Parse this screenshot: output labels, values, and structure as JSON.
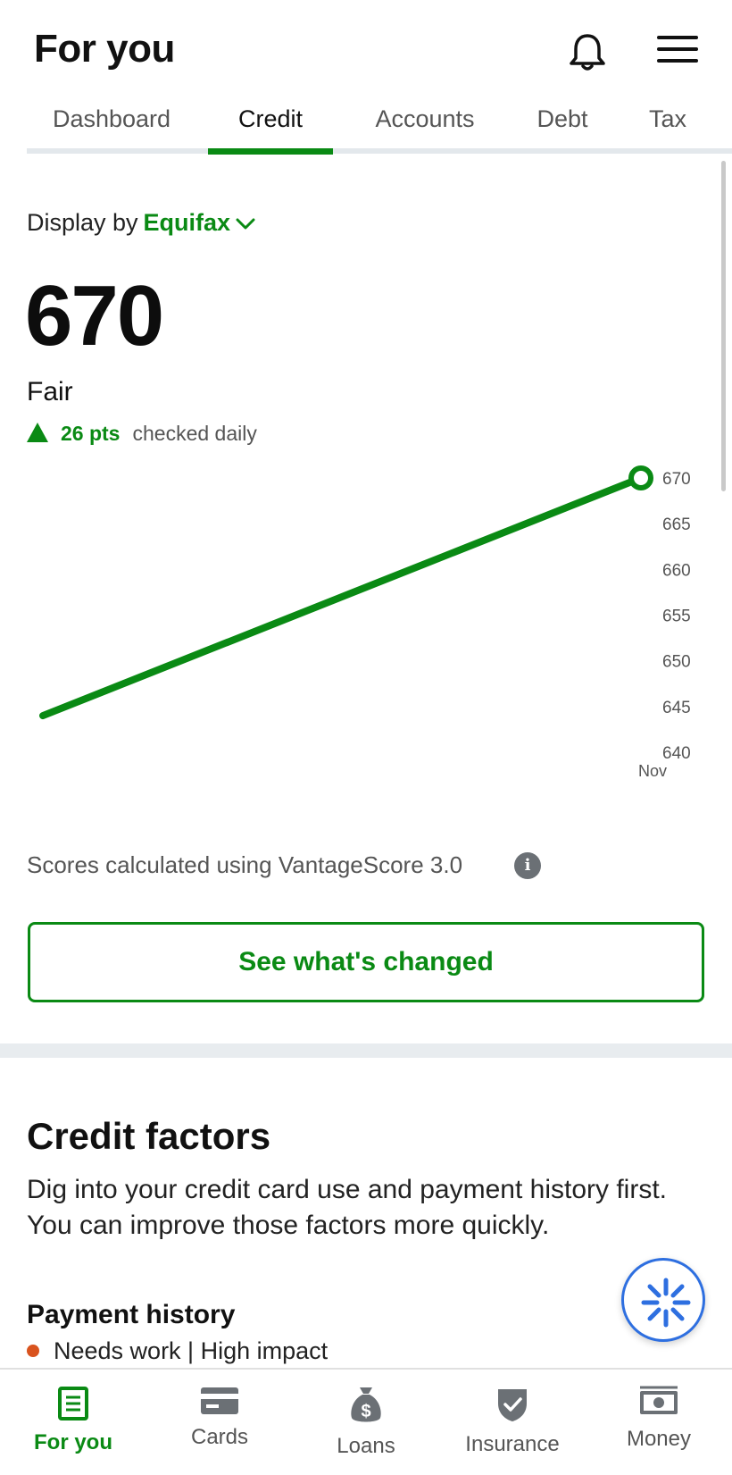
{
  "header": {
    "title": "For you"
  },
  "tabs": [
    {
      "label": "Dashboard",
      "active": false
    },
    {
      "label": "Credit",
      "active": true
    },
    {
      "label": "Accounts",
      "active": false
    },
    {
      "label": "Debt",
      "active": false
    },
    {
      "label": "Tax",
      "active": false
    }
  ],
  "display": {
    "prefix": "Display by",
    "bureau": "Equifax"
  },
  "score": {
    "value": "670",
    "rating": "Fair",
    "change": "26 pts",
    "change_direction": "up",
    "frequency": "checked daily"
  },
  "chart_data": {
    "type": "line",
    "x": [
      "",
      "Nov"
    ],
    "x_tick_labels": [
      "Nov"
    ],
    "series": [
      {
        "values": [
          644,
          670
        ],
        "color": "#0a8a14"
      }
    ],
    "y_ticks": [
      "670",
      "665",
      "660",
      "655",
      "650",
      "645",
      "640"
    ],
    "ylim": [
      640,
      670
    ],
    "y_axis_side": "right",
    "grid": false
  },
  "footnote": "Scores calculated using VantageScore 3.0",
  "cta": {
    "label": "See what's changed"
  },
  "factors": {
    "title": "Credit factors",
    "description": "Dig into your credit card use and payment history first. You can improve those factors more quickly.",
    "items": [
      {
        "name": "Payment history",
        "status": "Needs work | High impact",
        "status_color": "#d9531e"
      }
    ]
  },
  "bottom_nav": [
    {
      "label": "For you",
      "icon": "document-icon",
      "active": true
    },
    {
      "label": "Cards",
      "icon": "credit-card-icon",
      "active": false
    },
    {
      "label": "Loans",
      "icon": "money-bag-icon",
      "active": false
    },
    {
      "label": "Insurance",
      "icon": "shield-icon",
      "active": false
    },
    {
      "label": "Money",
      "icon": "cash-icon",
      "active": false
    }
  ],
  "colors": {
    "brand_green": "#0a8a14",
    "warning_orange": "#d9531e",
    "assistant_blue": "#2e6fe0"
  }
}
